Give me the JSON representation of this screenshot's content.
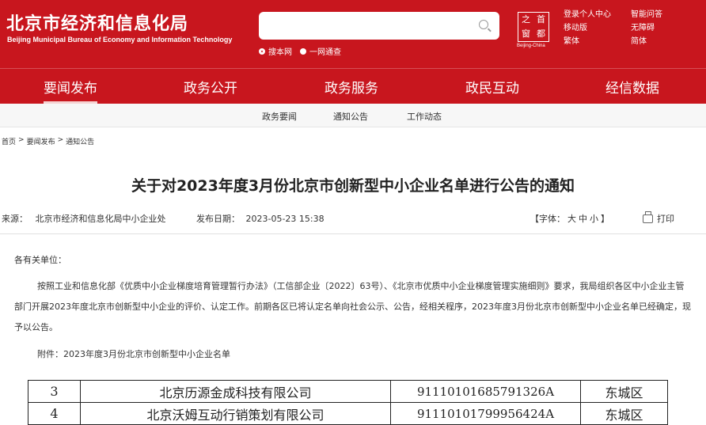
{
  "header": {
    "org_name": "北京市经济和信息化局",
    "org_name_en": "Beijing Municipal Bureau of Economy and Information Technology",
    "search": {
      "placeholder": ""
    },
    "search_scope": [
      {
        "label": "搜本网",
        "selected": true
      },
      {
        "label": "一网通查",
        "selected": false
      }
    ],
    "seal": {
      "chars": [
        "之",
        "首",
        "窗",
        "都"
      ],
      "subtitle": "Beijing-China"
    },
    "util_links": [
      "登录个人中心",
      "智能问答",
      "移动版",
      "无障碍",
      "繁体",
      "简体"
    ],
    "brand_color": "#c8161e"
  },
  "main_nav": [
    {
      "label": "要闻发布",
      "active": true
    },
    {
      "label": "政务公开",
      "active": false
    },
    {
      "label": "政务服务",
      "active": false
    },
    {
      "label": "政民互动",
      "active": false
    },
    {
      "label": "经信数据",
      "active": false
    }
  ],
  "sub_nav": [
    "政务要闻",
    "通知公告",
    "工作动态"
  ],
  "breadcrumb": [
    "首页",
    ">",
    "要闻发布",
    ">",
    "通知公告"
  ],
  "article": {
    "title": "关于对2023年度3月份北京市创新型中小企业名单进行公告的通知",
    "source_label": "来源：",
    "source": "北京市经济和信息化局中小企业处",
    "date_label": "发布日期：",
    "date": "2023-05-23 15:38",
    "font_size_label": "【字体：",
    "font_sizes": [
      "大",
      "中",
      "小"
    ],
    "font_size_close": "】",
    "print_label": "打印",
    "salutation": "各有关单位：",
    "paragraph": "按照工业和信息化部《优质中小企业梯度培育管理暂行办法》（工信部企业〔2022〕63号）、《北京市优质中小企业梯度管理实施细则》要求，我局组织各区中小企业主管部门开展2023年度北京市创新型中小企业的评价、认定工作。前期各区已将认定名单向社会公示、公告，经相关程序，2023年度3月份北京市创新型中小企业名单已经确定，现予以公告。",
    "attachment": "附件：2023年度3月份北京市创新型中小企业名单"
  },
  "table": {
    "rows": [
      {
        "no": "3",
        "name": "北京历源金成科技有限公司",
        "code": "91110101685791326A",
        "district": "东城区"
      },
      {
        "no": "4",
        "name": "北京沃姆互动行销策划有限公司",
        "code": "91110101799956424A",
        "district": "东城区"
      }
    ]
  }
}
